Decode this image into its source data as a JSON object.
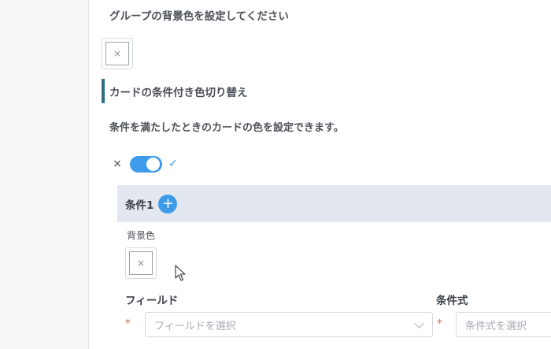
{
  "group_background": {
    "label": "グループの背景色を設定してください",
    "swatch_icon": "×"
  },
  "conditional_color": {
    "section_title": "カードの条件付き色切り替え",
    "description": "条件を満たしたときのカードの色を設定できます。",
    "toggle": {
      "off_icon": "×",
      "on_icon": "✓",
      "state": "on"
    }
  },
  "condition": {
    "title": "条件1",
    "add_icon": "+",
    "background_label": "背景色",
    "swatch_icon": "×",
    "field": {
      "label": "フィールド",
      "required_mark": "*",
      "placeholder": "フィールドを選択"
    },
    "expression": {
      "label": "条件式",
      "required_mark": "*",
      "placeholder": "条件式を選択"
    }
  },
  "colors": {
    "accent": "#3d9be9",
    "section_border": "#2f6f86",
    "condition_bg": "#e3e8f0"
  }
}
